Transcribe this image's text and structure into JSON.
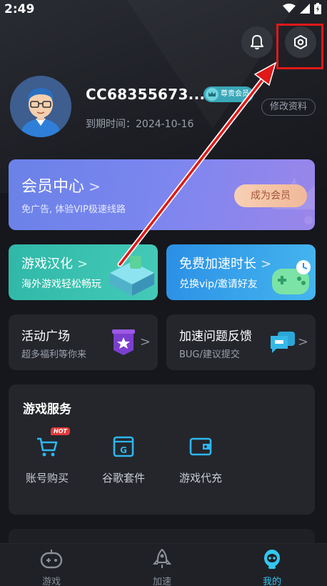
{
  "status_bar": {
    "time": "2:49"
  },
  "profile": {
    "username": "CC68355673...",
    "badge": "尊贵会员",
    "expiry_text": "到期时间：2024-10-16",
    "edit_label": "修改资料"
  },
  "vip_card": {
    "title": "会员中心",
    "subtitle": "免广告, 体验VIP极速线路",
    "button": "成为会员"
  },
  "feature_cards": [
    {
      "title": "游戏汉化",
      "subtitle": "海外游戏轻松畅玩"
    },
    {
      "title": "免费加速时长",
      "subtitle": "兑换vip/邀请好友"
    }
  ],
  "small_cards": [
    {
      "title": "活动广场",
      "subtitle": "超多福利等你来"
    },
    {
      "title": "加速问题反馈",
      "subtitle": "BUG/建议提交"
    }
  ],
  "game_services": {
    "title": "游戏服务",
    "hot_tag": "HOT",
    "items": [
      {
        "label": "账号购买",
        "icon": "cart-icon"
      },
      {
        "label": "谷歌套件",
        "icon": "google-suite-icon"
      },
      {
        "label": "游戏代充",
        "icon": "wallet-icon"
      }
    ]
  },
  "tabbar": {
    "items": [
      {
        "label": "游戏",
        "icon": "gamepad-icon"
      },
      {
        "label": "加速",
        "icon": "rocket-icon"
      },
      {
        "label": "我的",
        "icon": "profile-robot-icon"
      }
    ],
    "active_index": 2
  },
  "colors": {
    "accent": "#33c7f0",
    "highlight_box": "#e01818",
    "arrow": "#e01818"
  }
}
